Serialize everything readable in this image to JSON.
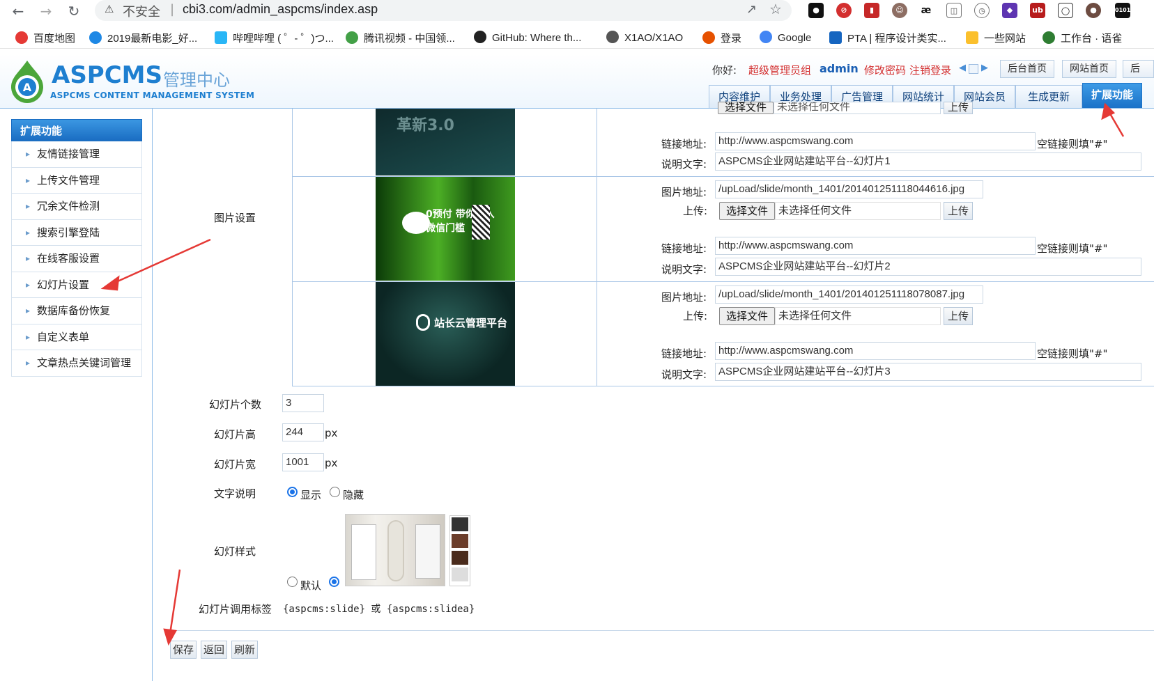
{
  "browser": {
    "insecure_label": "不安全",
    "separator": "|",
    "url": "cbi3.com/admin_aspcms/index.asp",
    "bookmarks": [
      {
        "label": "百度地图",
        "color": "#e53935"
      },
      {
        "label": "2019最新电影_好...",
        "color": "#1e88e5"
      },
      {
        "label": "哔哩哔哩 ( ゜- ゜)つ...",
        "color": "#29b6f6"
      },
      {
        "label": "腾讯视频 - 中国领...",
        "color": "#43a047"
      },
      {
        "label": "GitHub: Where th...",
        "color": "#222222"
      },
      {
        "label": "X1AO/X1AO",
        "color": "#555555"
      },
      {
        "label": "登录",
        "color": "#e65100"
      },
      {
        "label": "Google",
        "color": "#4285f4"
      },
      {
        "label": "PTA | 程序设计类实...",
        "color": "#1565c0"
      },
      {
        "label": "一些网站",
        "color": "#fbc02d"
      },
      {
        "label": "工作台 · 语雀",
        "color": "#2e7d32"
      }
    ]
  },
  "header": {
    "logo_main": "ASPCMS",
    "logo_cn": "管理中心",
    "logo_en": "ASPCMS CONTENT MANAGEMENT SYSTEM",
    "greeting": "你好:",
    "role": "超级管理员组",
    "username": "admin",
    "change_password": "修改密码",
    "logout": "注销登录",
    "buttons": [
      "后台首页",
      "网站首页",
      "后台"
    ],
    "tabs": [
      "内容维护",
      "业务处理",
      "广告管理",
      "网站统计",
      "网站会员",
      "生成更新",
      "扩展功能"
    ],
    "active_tab": "扩展功能"
  },
  "sidebar": {
    "title": "扩展功能",
    "items": [
      "友情链接管理",
      "上传文件管理",
      "冗余文件检测",
      "搜索引擎登陆",
      "在线客服设置",
      "幻灯片设置",
      "数据库备份恢复",
      "自定义表单",
      "文章热点关键词管理"
    ]
  },
  "main": {
    "image_settings_label": "图片设置",
    "field_labels": {
      "image_url": "图片地址:",
      "upload": "上传:",
      "link_url": "链接地址:",
      "desc": "说明文字:"
    },
    "choose_file": "选择文件",
    "no_file": "未选择任何文件",
    "upload_btn": "上传",
    "empty_link_hint": "空链接则填\"#\"",
    "slides": [
      {
        "image_url": "",
        "link": "http://www.aspcmswang.com",
        "desc": "ASPCMS企业网站建站平台--幻灯片1",
        "img_text": "革新3.0",
        "colors": [
          "#0f2a2c",
          "#1a4a4c"
        ]
      },
      {
        "image_url": "/upLoad/slide/month_1401/20140125111804​4616.jpg",
        "link": "http://www.aspcmswang.com",
        "desc": "ASPCMS企业网站建站平台--幻灯片2",
        "img_text": "0预付 带你跨入微信门槛",
        "colors": [
          "#134d0c",
          "#5fbf2a"
        ]
      },
      {
        "image_url": "/upLoad/slide/month_1401/20140125111807​8087.jpg",
        "link": "http://www.aspcmswang.com",
        "desc": "ASPCMS企业网站建站平台--幻灯片3",
        "img_text": "站长云管理平台",
        "colors": [
          "#0d2d2a",
          "#1d524c"
        ]
      }
    ],
    "count_label": "幻灯片个数",
    "count_value": "3",
    "height_label": "幻灯片高",
    "height_value": "244",
    "width_label": "幻灯片宽",
    "width_value": "1001",
    "px": "px",
    "text_desc_label": "文字说明",
    "show_label": "显示",
    "hide_label": "隐藏",
    "style_label": "幻灯样式",
    "default_label": "默认",
    "tag_label": "幻灯片调用标签",
    "tag_value": "{aspcms:slide} 或 {aspcms:slidea}",
    "save": "保存",
    "back": "返回",
    "refresh": "刷新"
  }
}
